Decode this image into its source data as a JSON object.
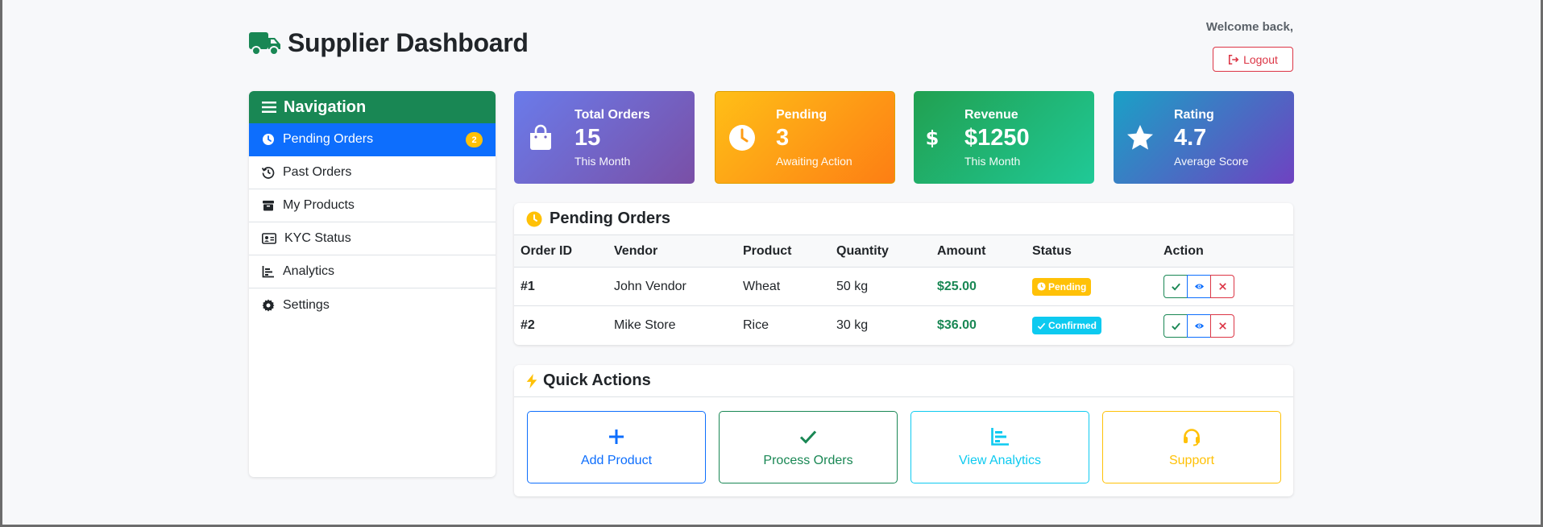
{
  "header": {
    "title": "Supplier Dashboard",
    "welcome": "Welcome back,",
    "logout_label": "Logout"
  },
  "sidebar": {
    "title": "Navigation",
    "items": [
      {
        "label": "Pending Orders",
        "icon": "clock-icon",
        "badge": "2",
        "active": true
      },
      {
        "label": "Past Orders",
        "icon": "history-icon"
      },
      {
        "label": "My Products",
        "icon": "box-icon"
      },
      {
        "label": "KYC Status",
        "icon": "id-card-icon"
      },
      {
        "label": "Analytics",
        "icon": "chart-icon"
      },
      {
        "label": "Settings",
        "icon": "gear-icon"
      }
    ]
  },
  "stats": [
    {
      "label": "Total Orders",
      "value": "15",
      "sub": "This Month",
      "icon": "shopping-bag-icon"
    },
    {
      "label": "Pending",
      "value": "3",
      "sub": "Awaiting Action",
      "icon": "clock-icon"
    },
    {
      "label": "Revenue",
      "value": "$1250",
      "sub": "This Month",
      "icon": "dollar-icon"
    },
    {
      "label": "Rating",
      "value": "4.7",
      "sub": "Average Score",
      "icon": "star-icon"
    }
  ],
  "orders": {
    "title": "Pending Orders",
    "columns": [
      "Order ID",
      "Vendor",
      "Product",
      "Quantity",
      "Amount",
      "Status",
      "Action"
    ],
    "rows": [
      {
        "id": "#1",
        "vendor": "John Vendor",
        "product": "Wheat",
        "quantity": "50 kg",
        "amount": "$25.00",
        "status": "Pending"
      },
      {
        "id": "#2",
        "vendor": "Mike Store",
        "product": "Rice",
        "quantity": "30 kg",
        "amount": "$36.00",
        "status": "Confirmed"
      }
    ]
  },
  "quick_actions": {
    "title": "Quick Actions",
    "items": [
      {
        "label": "Add Product",
        "icon": "plus-icon"
      },
      {
        "label": "Process Orders",
        "icon": "check-icon"
      },
      {
        "label": "View Analytics",
        "icon": "chart-icon"
      },
      {
        "label": "Support",
        "icon": "headset-icon"
      }
    ]
  },
  "colors": {
    "primary": "#0d6efd",
    "success": "#198754",
    "warning": "#ffc107",
    "danger": "#dc3545",
    "info": "#0dcaf0"
  }
}
